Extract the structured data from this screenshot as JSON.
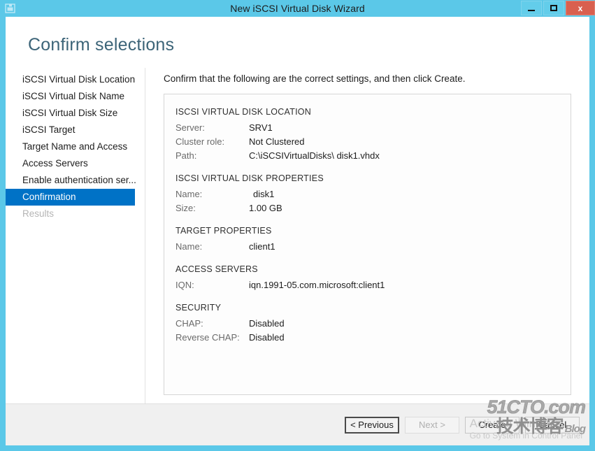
{
  "window": {
    "title": "New iSCSI Virtual Disk Wizard",
    "icon": "iscsi-disk-icon",
    "minimize_label": "",
    "maximize_label": "",
    "close_label": "x",
    "border_color": "#5bc8e8"
  },
  "page": {
    "title": "Confirm selections",
    "title_color": "#3c6478",
    "instruction": "Confirm that the following are the correct settings, and then click Create."
  },
  "sidebar": {
    "selected_color": "#0072c6",
    "items": [
      {
        "label": "iSCSI Virtual Disk Location",
        "state": "normal"
      },
      {
        "label": "iSCSI Virtual Disk Name",
        "state": "normal"
      },
      {
        "label": "iSCSI Virtual Disk Size",
        "state": "normal"
      },
      {
        "label": "iSCSI Target",
        "state": "normal"
      },
      {
        "label": "Target Name and Access",
        "state": "normal"
      },
      {
        "label": "Access Servers",
        "state": "normal"
      },
      {
        "label": "Enable authentication ser...",
        "state": "normal"
      },
      {
        "label": "Confirmation",
        "state": "selected"
      },
      {
        "label": "Results",
        "state": "disabled"
      }
    ]
  },
  "summary": {
    "sections": [
      {
        "title": "ISCSI VIRTUAL DISK LOCATION",
        "rows": [
          {
            "key": "Server:",
            "value": "SRV1"
          },
          {
            "key": "Cluster role:",
            "value": "Not Clustered"
          },
          {
            "key": "Path:",
            "value": "C:\\iSCSIVirtualDisks\\ disk1.vhdx"
          }
        ]
      },
      {
        "title": "ISCSI VIRTUAL DISK PROPERTIES",
        "rows": [
          {
            "key": "Name:",
            "value": "disk1",
            "indent": true
          },
          {
            "key": "Size:",
            "value": "1.00 GB"
          }
        ]
      },
      {
        "title": "TARGET PROPERTIES",
        "rows": [
          {
            "key": "Name:",
            "value": "client1"
          }
        ]
      },
      {
        "title": "ACCESS SERVERS",
        "rows": [
          {
            "key": "IQN:",
            "value": "iqn.1991-05.com.microsoft:client1"
          }
        ]
      },
      {
        "title": "SECURITY",
        "rows": [
          {
            "key": "CHAP:",
            "value": "Disabled"
          },
          {
            "key": "Reverse CHAP:",
            "value": "Disabled"
          }
        ]
      }
    ]
  },
  "footer": {
    "previous_label": "< Previous",
    "next_label": "Next >",
    "create_label": "Create",
    "cancel_label": "Cancel"
  },
  "overlays": {
    "activate_line1": "Activate Windows",
    "activate_line2": "Go to System in Control Panel",
    "cto_top": "51CTO.com",
    "cto_bottom": "技术博客",
    "cto_blog": "Blog"
  }
}
